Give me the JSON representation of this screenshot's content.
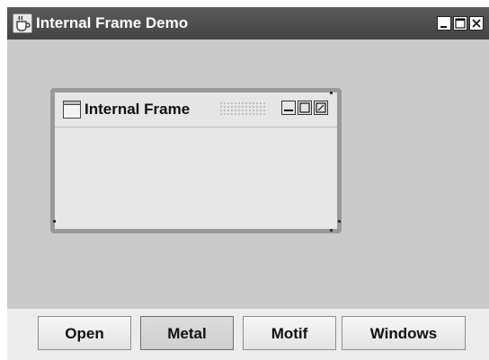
{
  "window": {
    "title": "Internal Frame Demo",
    "icon": "java-coffee-cup-icon",
    "controls": [
      "minimize-icon",
      "maximize-icon",
      "close-icon"
    ]
  },
  "internal_frame": {
    "title": "Internal Frame",
    "icon": "frame-icon",
    "controls": [
      "iconify-icon",
      "maximize-icon",
      "close-icon"
    ]
  },
  "buttons": {
    "open": "Open",
    "metal": "Metal",
    "motif": "Motif",
    "windows": "Windows",
    "selected": "Metal"
  },
  "colors": {
    "titlebar": "#4a4a4a",
    "desktop": "#cacaca",
    "frame_border": "#9a9a9a"
  }
}
